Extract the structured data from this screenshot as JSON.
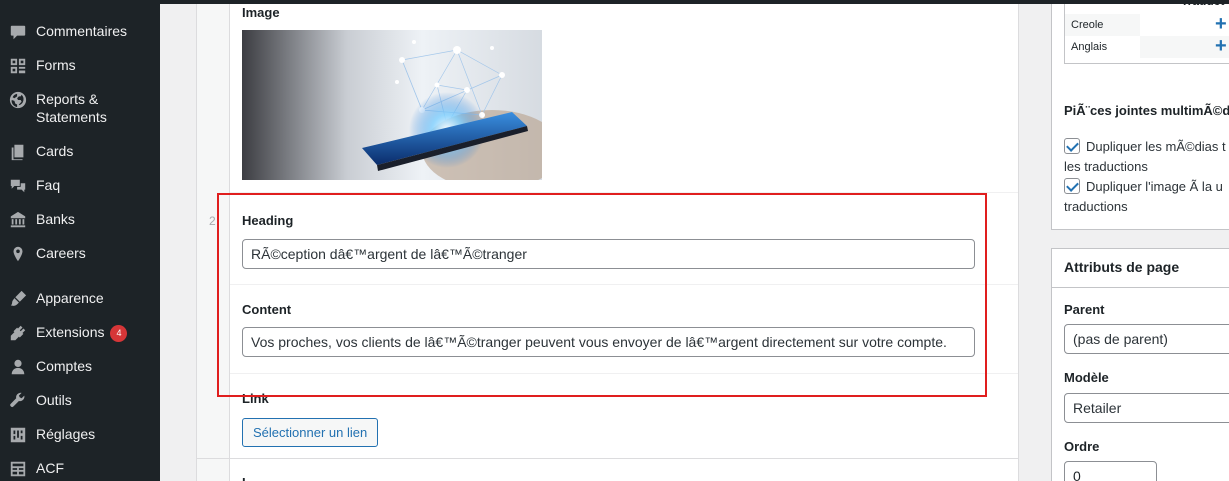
{
  "sidebar": {
    "items": [
      {
        "label": "Commentaires",
        "icon": "comment-icon"
      },
      {
        "label": "Forms",
        "icon": "forms-icon"
      },
      {
        "label": "Reports & Statements",
        "icon": "globe-icon"
      },
      {
        "label": "Cards",
        "icon": "pages-icon"
      },
      {
        "label": "Faq",
        "icon": "faq-icon"
      },
      {
        "label": "Banks",
        "icon": "bank-icon"
      },
      {
        "label": "Careers",
        "icon": "careers-icon"
      },
      {
        "label": "Apparence",
        "icon": "brush-icon"
      },
      {
        "label": "Extensions",
        "icon": "plugin-icon",
        "badge": "4"
      },
      {
        "label": "Comptes",
        "icon": "user-icon"
      },
      {
        "label": "Outils",
        "icon": "wrench-icon"
      },
      {
        "label": "Réglages",
        "icon": "settings-icon"
      },
      {
        "label": "ACF",
        "icon": "acf-icon"
      }
    ]
  },
  "repeater": {
    "row_index": "2",
    "image_label": "Image",
    "heading_label": "Heading",
    "heading_value": "RÃ©ception dâ€™argent de lâ€™Ã©tranger",
    "content_label": "Content",
    "content_value": "Vos proches, vos clients de lâ€™Ã©tranger peuvent vous envoyer de lâ€™argent directement sur votre compte.",
    "link_label": "Link",
    "link_button": "Sélectionner un lien",
    "next_row_label": "I"
  },
  "translations": {
    "header": "Traduct",
    "languages": [
      "Creole",
      "Anglais"
    ],
    "add_symbol": "+"
  },
  "media": {
    "title": "PiÃ¨ces jointes multimÃ©d",
    "checkbox1": "Dupliquer les mÃ©dias t vers les traductions",
    "checkbox2": "Dupliquer l'image Ã  la u traductions"
  },
  "page_attributes": {
    "title": "Attributs de page",
    "parent_label": "Parent",
    "parent_value": "(pas de parent)",
    "model_label": "Modèle",
    "model_value": "Retailer",
    "order_label": "Ordre",
    "order_value": "0"
  },
  "colors": {
    "sidebar_bg": "#1d2327",
    "accent": "#2271b1",
    "highlight": "#e01e1e",
    "badge": "#d63638"
  }
}
